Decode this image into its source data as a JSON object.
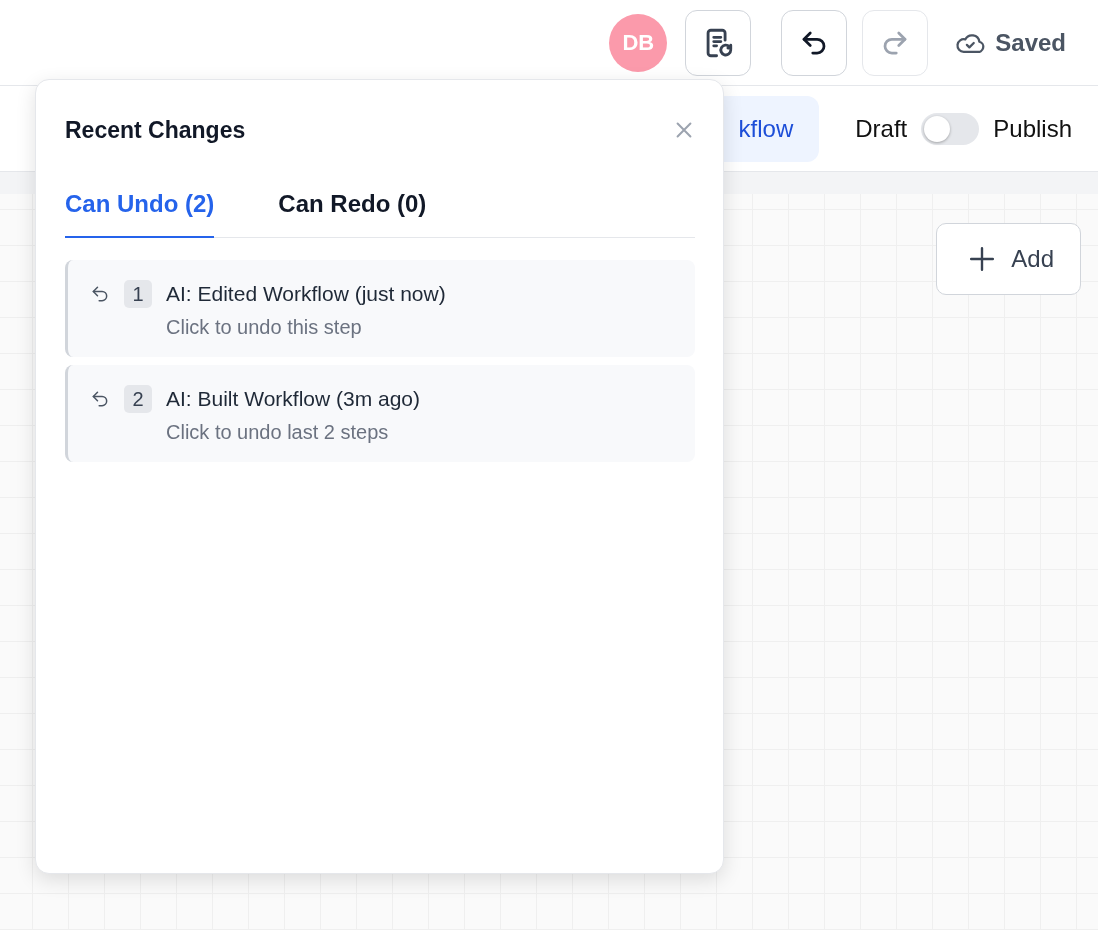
{
  "header": {
    "avatar": "DB",
    "undo": {
      "disabled": false
    },
    "redo": {
      "disabled": true
    },
    "status": "Saved"
  },
  "subbar": {
    "tab_label": "kflow",
    "draft_label": "Draft",
    "toggle": {
      "on": false
    },
    "publish_label": "Publish"
  },
  "canvas": {
    "add_button": "Add"
  },
  "popover": {
    "title": "Recent Changes",
    "tabs": [
      {
        "label": "Can Undo (2)",
        "selected": true
      },
      {
        "label": "Can Redo (0)",
        "selected": false
      }
    ],
    "items": [
      {
        "index": "1",
        "title": "AI: Edited Workflow (just now)",
        "hint": "Click to undo this step"
      },
      {
        "index": "2",
        "title": "AI: Built Workflow (3m ago)",
        "hint": "Click to undo last 2 steps"
      }
    ]
  }
}
